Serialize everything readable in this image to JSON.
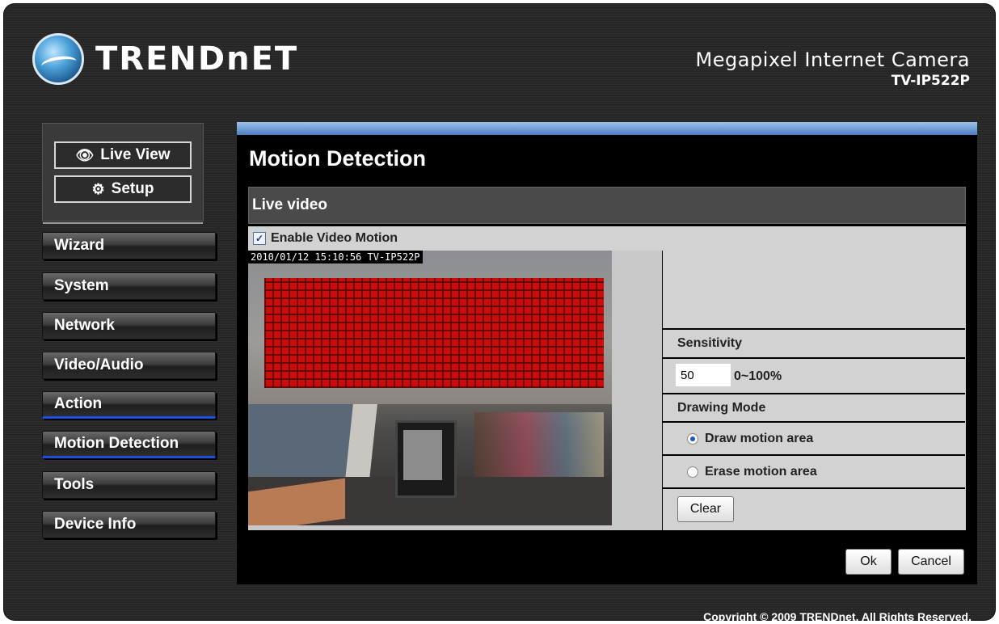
{
  "header": {
    "logo_text": "TRENDnET",
    "product_name": "Megapixel Internet Camera",
    "model": "TV-IP522P"
  },
  "top_nav": {
    "live_view_label": "Live View",
    "setup_label": "Setup"
  },
  "sidebar": {
    "items": [
      {
        "label": "Wizard"
      },
      {
        "label": "System"
      },
      {
        "label": "Network"
      },
      {
        "label": "Video/Audio"
      },
      {
        "label": "Action"
      },
      {
        "label": "Motion Detection"
      },
      {
        "label": "Tools"
      },
      {
        "label": "Device Info"
      }
    ]
  },
  "main": {
    "title": "Motion Detection",
    "section_title": "Live video",
    "enable_label": "Enable Video Motion",
    "enable_checked": true,
    "timestamp_overlay": "2010/01/12 15:10:56 TV-IP522P",
    "sensitivity_label": "Sensitivity",
    "sensitivity_value": "50",
    "sensitivity_range": "0~100%",
    "drawing_mode_label": "Drawing Mode",
    "draw_option": "Draw motion area",
    "erase_option": "Erase motion area",
    "selected_mode": "draw",
    "clear_label": "Clear",
    "ok_label": "Ok",
    "cancel_label": "Cancel"
  },
  "footer": {
    "copyright": "Copyright © 2009 TRENDnet. All Rights Reserved."
  },
  "colors": {
    "accent_blue": "#1b4fe0",
    "motion_grid": "#d10000",
    "background": "#262626"
  }
}
